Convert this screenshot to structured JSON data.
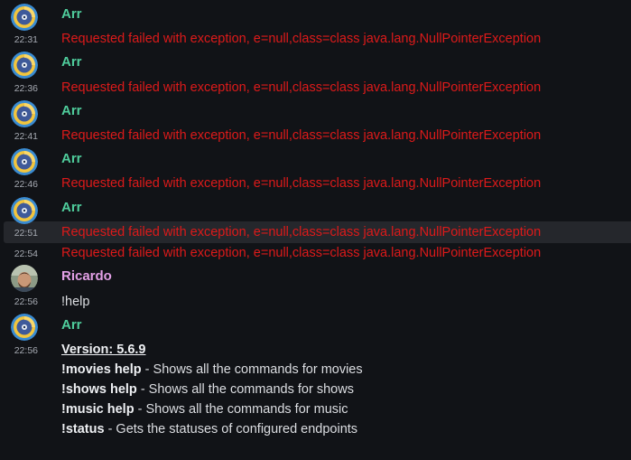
{
  "bot": {
    "name": "Arr"
  },
  "user": {
    "name": "Ricardo"
  },
  "messages": [
    {
      "time": "22:31",
      "author": "Arr",
      "text": "Requested failed with exception, e=null,class=class java.lang.NullPointerException"
    },
    {
      "time": "22:36",
      "author": "Arr",
      "text": "Requested failed with exception, e=null,class=class java.lang.NullPointerException"
    },
    {
      "time": "22:41",
      "author": "Arr",
      "text": "Requested failed with exception, e=null,class=class java.lang.NullPointerException"
    },
    {
      "time": "22:46",
      "author": "Arr",
      "text": "Requested failed with exception, e=null,class=class java.lang.NullPointerException"
    },
    {
      "time": "22:51",
      "author": "Arr",
      "text": "Requested failed with exception, e=null,class=class java.lang.NullPointerException"
    },
    {
      "time": "22:51",
      "text": "Requested failed with exception, e=null,class=class java.lang.NullPointerException"
    },
    {
      "time": "22:54",
      "text": "Requested failed with exception, e=null,class=class java.lang.NullPointerException"
    },
    {
      "time": "22:56",
      "author": "Ricardo",
      "text": "!help"
    },
    {
      "time": "22:56",
      "author": "Arr",
      "version": "Version: 5.6.9",
      "commands": [
        {
          "cmd": "!movies help",
          "desc": " - Shows all the commands for movies"
        },
        {
          "cmd": "!shows help",
          "desc": " - Shows all the commands for shows"
        },
        {
          "cmd": "!music help",
          "desc": " - Shows all the commands for music"
        },
        {
          "cmd": "!status",
          "desc": " - Gets the statuses of configured endpoints"
        }
      ]
    }
  ],
  "colors": {
    "background": "#111317",
    "bot_name": "#4fcd9c",
    "user_name": "#e3a0e6",
    "error_text": "#dd1a1a",
    "timestamp": "#a6aab2",
    "hover_row": "#25272c"
  },
  "icons": {
    "bot_avatar": "vinyl-disc-icon",
    "user_avatar": "user-photo-avatar"
  }
}
